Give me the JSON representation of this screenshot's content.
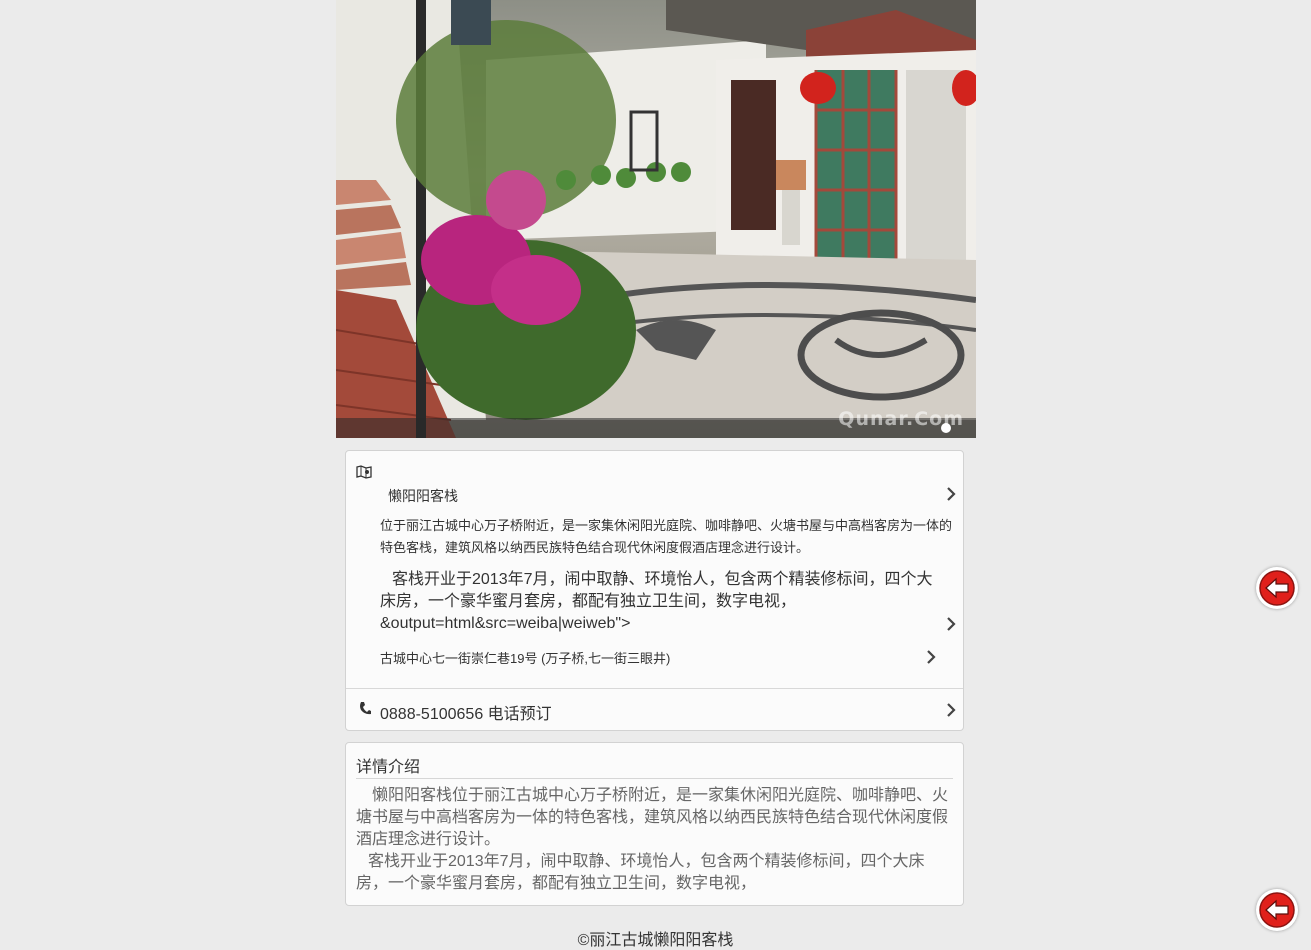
{
  "hero": {
    "watermark": "Qunar.Com",
    "slides_total": 1,
    "active_slide": 1
  },
  "info": {
    "hotel_name": "懒阳阳客栈",
    "description_short": "位于丽江古城中心万子桥附近，是一家集休闲阳光庭院、咖啡静吧、火塘书屋与中高档客房为一体的特色客栈，建筑风格以纳西民族特色结合现代休闲度假酒店理念进行设计。",
    "description_long": "客栈开业于2013年7月，闹中取静、环境怡人，包含两个精装修标间，四个大床房，一个豪华蜜月套房，都配有独立卫生间，数字电视，&output=html&src=weiba|weiweb\">",
    "address": "古城中心七一街崇仁巷19号 (万子桥,七一街三眼井)",
    "phone": "0888-5100656 电话预订"
  },
  "detail": {
    "title": "详情介绍",
    "paragraph1": "懒阳阳客栈位于丽江古城中心万子桥附近，是一家集休闲阳光庭院、咖啡静吧、火塘书屋与中高档客房为一体的特色客栈，建筑风格以纳西民族特色结合现代休闲度假酒店理念进行设计。",
    "paragraph2": "客栈开业于2013年7月，闹中取静、环境怡人，包含两个精装修标间，四个大床房，一个豪华蜜月套房，都配有独立卫生间，数字电视，"
  },
  "footer": {
    "copyright": "©丽江古城懒阳阳客栈"
  },
  "colors": {
    "back_button_red": "#e0201b",
    "card_border": "#d2d2d2",
    "page_background": "#ebebeb"
  }
}
